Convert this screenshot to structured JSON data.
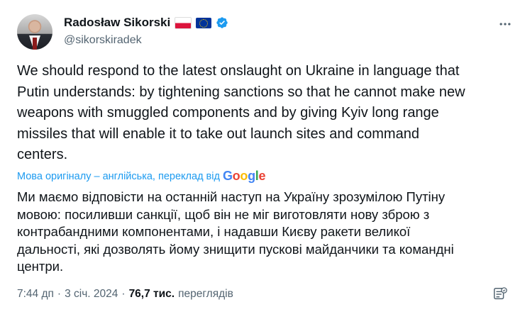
{
  "author": {
    "name": "Radosław Sikorski",
    "handle": "@sikorskiradek",
    "flags": [
      "poland-flag-icon",
      "eu-flag-icon"
    ],
    "verified_icon": "verified-badge-icon"
  },
  "more_icon": "more-icon",
  "tweet": {
    "text": "We should respond to the latest onslaught on Ukraine in language that\nPutin understands: by tightening sanctions so that he cannot make new\nweapons with smuggled components and by giving Kyiv long range\nmissiles that will enable it to take out launch sites and command\ncenters.",
    "translation_note": "Мова оригіналу – англійська, переклад від",
    "translation_provider": "Google",
    "translated_text": "Ми маємо відповісти на останній наступ на Україну зрозумілою Путіну\nмовою: посиливши санкції, щоб він не міг виготовляти нову зброю з\nконтрабандними компонентами, і надавши Києву ракети великої\nдальності, які дозволять йому знищити пускові майданчики та командні\nцентри."
  },
  "meta": {
    "time": "7:44 дп",
    "separator": "·",
    "date": "3 січ. 2024",
    "views_count": "76,7 тис.",
    "views_label": "переглядів"
  },
  "colors": {
    "text": "#0f1419",
    "secondary": "#536471",
    "accent": "#1d9bf0"
  }
}
